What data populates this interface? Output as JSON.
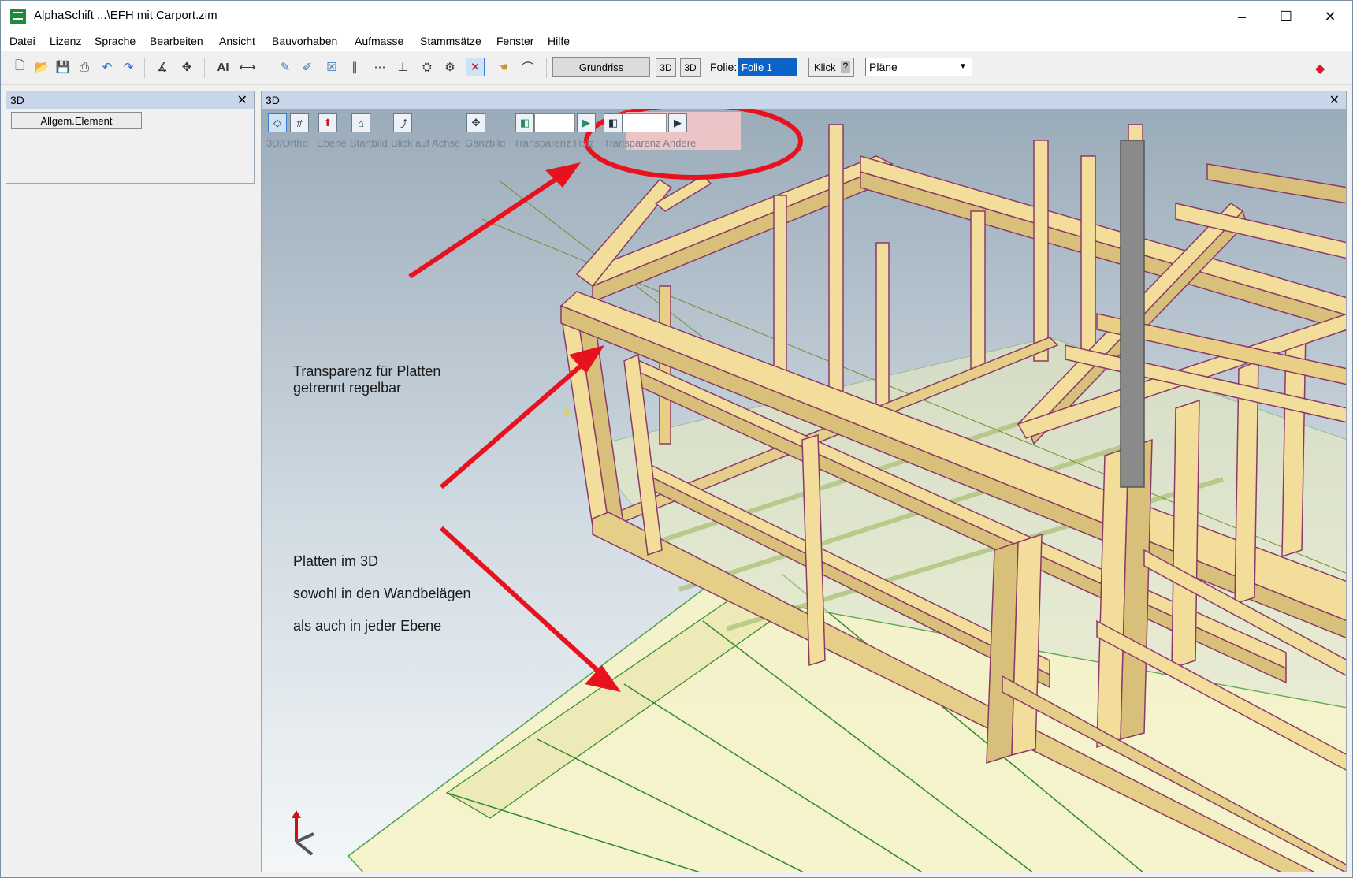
{
  "window": {
    "title": "AlphaSchift ...\\EFH mit Carport.zim",
    "controls": [
      "–",
      "☐",
      "✕"
    ]
  },
  "menu": [
    "Datei",
    "Lizenz",
    "Sprache",
    "Bearbeiten",
    "Ansicht",
    "Bauvorhaben",
    "Aufmasse",
    "Stammsätze",
    "Fenster",
    "Hilfe"
  ],
  "toolbar": {
    "grundriss_label": "Grundriss",
    "view3d_a": "3D",
    "view3d_b": "3D",
    "folie_label": "Folie:",
    "folie_value": "Folie 1",
    "klick_label": "Klick",
    "klick_help": "?",
    "plaene_value": "Pläne"
  },
  "left_panel": {
    "title": "3D",
    "button": "Allgem.Element"
  },
  "viewport": {
    "title": "3D",
    "tools": {
      "ortho": "3D/Ortho",
      "ebene": "Ebene",
      "startbild": "Startbild",
      "blick": "Blick auf Achse",
      "ganzbild": "Ganzbild",
      "trans_holz": "Transparenz Holz",
      "trans_andere": "Transparenz Andere"
    }
  },
  "annotations": {
    "transparency_line1": "Transparenz für Platten",
    "transparency_line2": "getrennt regelbar",
    "platten_line1": "Platten im 3D",
    "platten_line2": "sowohl in den Wandbelägen",
    "platten_line3": "als auch in jeder Ebene"
  },
  "colors": {
    "accent_blue": "#0a63c9",
    "annotation_red": "#e8121e",
    "timber": "#f2dd9a",
    "panel_header": "#c7d6e8"
  }
}
